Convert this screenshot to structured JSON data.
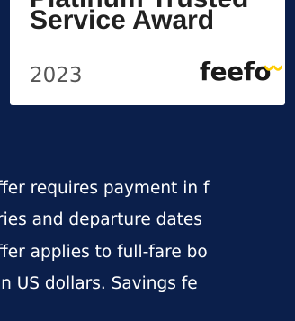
{
  "badge": {
    "title_line1": "Platinum Trusted",
    "title_line2": "Service Award",
    "year": "2023",
    "logo_text": "feefo",
    "logo_color": "#ffcc00"
  },
  "terms": {
    "lines": [
      "ffer requires payment in f",
      "ries and departure dates",
      "ffer applies to full-fare bo",
      " in US dollars. Savings fe"
    ]
  },
  "colors": {
    "background": "#0b1f4b",
    "badge_background": "#ffffff"
  }
}
